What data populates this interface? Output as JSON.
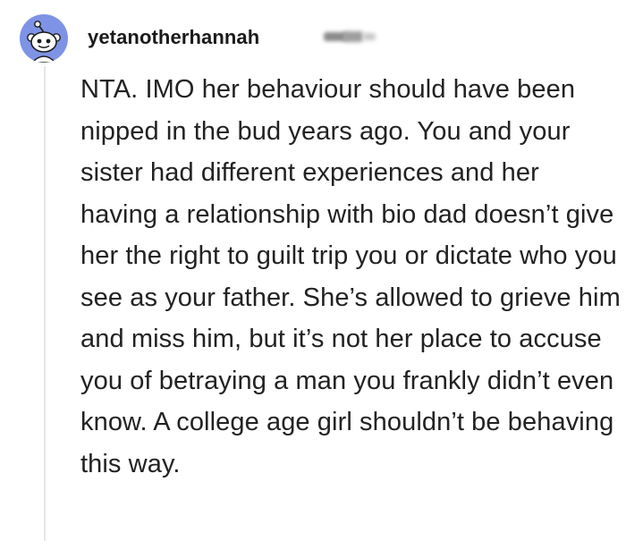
{
  "comment": {
    "username": "yetanotherhannah",
    "avatar_icon": "reddit-snoo-avatar-icon",
    "avatar_color": "#7E93E5",
    "body": "NTA. IMO her behaviour should have been nipped in the bud years ago. You and your sister had different experiences and her having a relationship with bio dad doesn’t give her the right to guilt trip you or dictate who you see as your father. She’s allowed to grieve him and miss him, but it’s not her place to accuse you of betraying a man you frankly didn’t even know. A college age girl shouldn’t be behaving this way."
  }
}
